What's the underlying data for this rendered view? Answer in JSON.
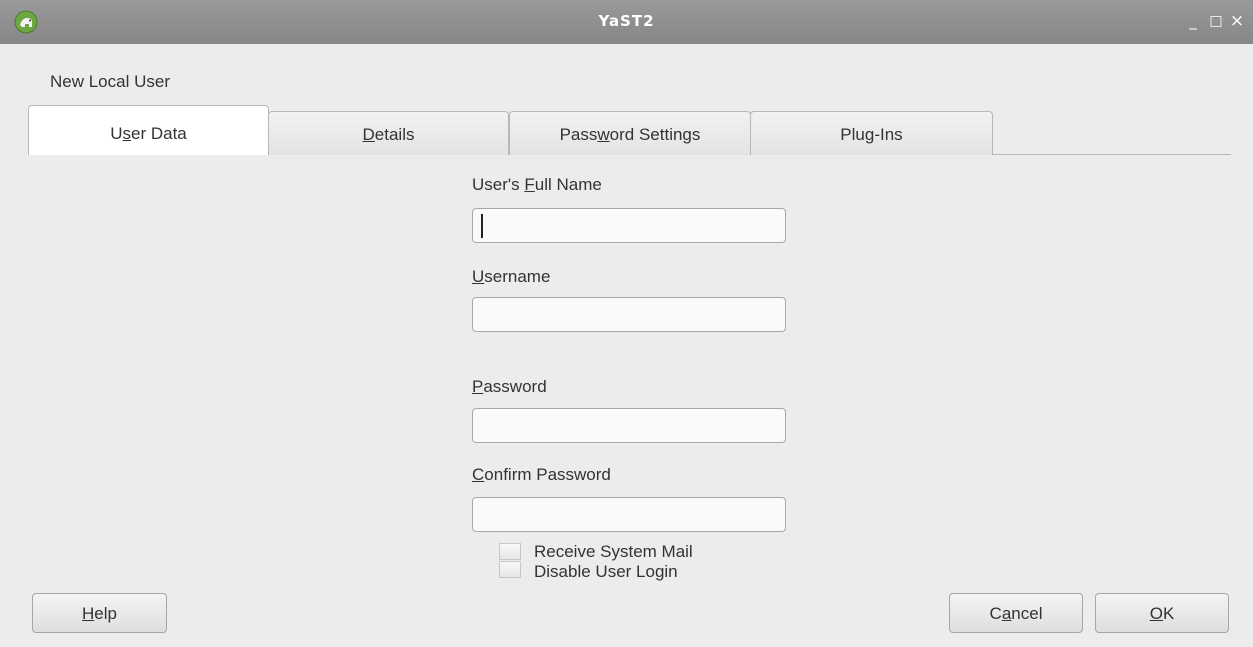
{
  "window": {
    "title": "YaST2",
    "controls": {
      "minimize": "_",
      "maximize": "□",
      "close": "×"
    }
  },
  "dialog": {
    "heading": "New Local User"
  },
  "tabs": [
    {
      "pre": "U",
      "key": "s",
      "post": "er Data",
      "active": true
    },
    {
      "pre": "",
      "key": "D",
      "post": "etails",
      "active": false
    },
    {
      "pre": "Pass",
      "key": "w",
      "post": "ord Settings",
      "active": false
    },
    {
      "pre": "Plu",
      "key": "g",
      "post": "-Ins",
      "active": false
    }
  ],
  "form": {
    "full_name": {
      "pre": "User's ",
      "key": "F",
      "post": "ull Name",
      "value": ""
    },
    "username": {
      "pre": "",
      "key": "U",
      "post": "sername",
      "value": ""
    },
    "password": {
      "pre": "",
      "key": "P",
      "post": "assword",
      "value": ""
    },
    "confirm_password": {
      "pre": "",
      "key": "C",
      "post": "onfirm Password",
      "value": ""
    },
    "receive_mail": {
      "label": "Receive System Mail",
      "checked": false
    },
    "disable_login": {
      "label": "Disable User Login",
      "checked": false
    }
  },
  "buttons": {
    "help": {
      "pre": "",
      "key": "H",
      "post": "elp"
    },
    "cancel": {
      "pre": "C",
      "key": "a",
      "post": "ncel"
    },
    "ok": {
      "pre": "",
      "key": "O",
      "post": "K"
    }
  },
  "colors": {
    "titlebar": "#8e8e8e",
    "window_bg": "#ececec",
    "app_icon": "#6da741"
  },
  "icons": {
    "app": "yast-chameleon-icon"
  }
}
